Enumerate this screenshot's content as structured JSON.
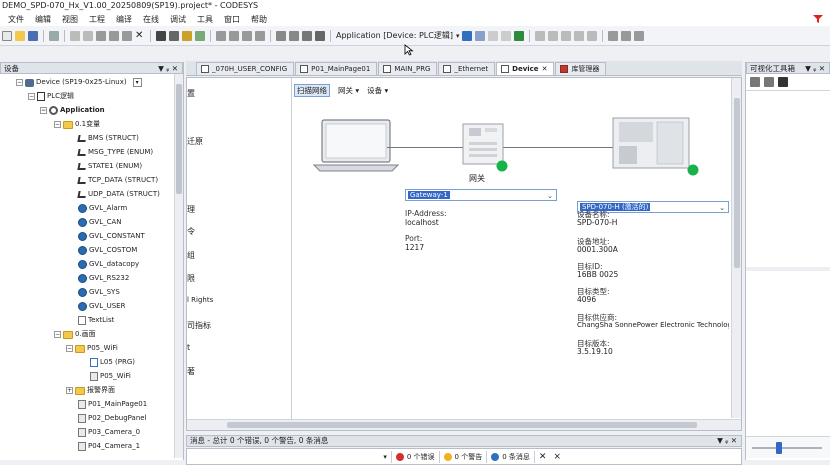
{
  "window": {
    "title": "DEMO_SPD-070_Hx_V1.00_20250809(SP19).project* - CODESYS"
  },
  "menu": [
    "文件",
    "编辑",
    "视图",
    "工程",
    "编译",
    "在线",
    "调试",
    "工具",
    "窗口",
    "帮助"
  ],
  "toolbar": {
    "application_label": "Application [Device: PLC逻辑]"
  },
  "devices_panel": {
    "title": "设备",
    "pin": "▼ ᵩ ✕",
    "tree": [
      {
        "label": "Device (SP19-0x25-Linux)",
        "icon": "device-icon",
        "level": 1,
        "toggle": "−"
      },
      {
        "label": "PLC逻辑",
        "icon": "plc-logic-icon",
        "level": 2,
        "toggle": "−"
      },
      {
        "label": "Application",
        "icon": "application-icon",
        "level": 3,
        "toggle": "−",
        "bold": true
      },
      {
        "label": "0.1变量",
        "icon": "folder-icon",
        "level": 4,
        "toggle": "−"
      },
      {
        "label": "BMS (STRUCT)",
        "icon": "struct-icon",
        "level": 5
      },
      {
        "label": "MSG_TYPE (ENUM)",
        "icon": "enum-icon",
        "level": 5
      },
      {
        "label": "STATE1 (ENUM)",
        "icon": "enum-icon",
        "level": 5
      },
      {
        "label": "TCP_DATA (STRUCT)",
        "icon": "struct-icon",
        "level": 5
      },
      {
        "label": "UDP_DATA (STRUCT)",
        "icon": "struct-icon",
        "level": 5
      },
      {
        "label": "GVL_Alarm",
        "icon": "gvl-icon",
        "level": 5
      },
      {
        "label": "GVL_CAN",
        "icon": "gvl-icon",
        "level": 5
      },
      {
        "label": "GVL_CONSTANT",
        "icon": "gvl-icon",
        "level": 5
      },
      {
        "label": "GVL_COSTOM",
        "icon": "gvl-icon",
        "level": 5
      },
      {
        "label": "GVL_datacopy",
        "icon": "gvl-icon",
        "level": 5
      },
      {
        "label": "GVL_RS232",
        "icon": "gvl-icon",
        "level": 5
      },
      {
        "label": "GVL_SYS",
        "icon": "gvl-icon",
        "level": 5
      },
      {
        "label": "GVL_USER",
        "icon": "gvl-icon",
        "level": 5
      },
      {
        "label": "TextList",
        "icon": "textlist-icon",
        "level": 5
      },
      {
        "label": "0.画面",
        "icon": "folder-icon",
        "level": 4,
        "toggle": "−"
      },
      {
        "label": "P05_WiFi",
        "icon": "folder-icon",
        "level": 5,
        "toggle": "−"
      },
      {
        "label": "L05 (PRG)",
        "icon": "program-icon",
        "level": 6
      },
      {
        "label": "P05_WiFi",
        "icon": "visu-icon",
        "level": 6
      },
      {
        "label": "报警界面",
        "icon": "folder-icon",
        "level": 5,
        "toggle": "+"
      },
      {
        "label": "P01_MainPage01",
        "icon": "visu-icon",
        "level": 5
      },
      {
        "label": "P02_DebugPanel",
        "icon": "visu-icon",
        "level": 5
      },
      {
        "label": "P03_Camera_0",
        "icon": "visu-icon",
        "level": 5
      },
      {
        "label": "P04_Camera_1",
        "icon": "visu-icon",
        "level": 5
      }
    ]
  },
  "editor_tabs": [
    {
      "label": "_070H_USER_CONFIG",
      "active": false
    },
    {
      "label": "P01_MainPage01",
      "active": false
    },
    {
      "label": "MAIN_PRG",
      "active": false
    },
    {
      "label": "_Ethernet",
      "active": false
    },
    {
      "label": "Device",
      "active": true,
      "close": "✕"
    },
    {
      "label": "库管理器",
      "active": false
    }
  ],
  "device_editor": {
    "sidebar": [
      "置",
      "迁原",
      "理",
      "令",
      "组",
      "限",
      "l Rights",
      "司指标",
      "t",
      "著"
    ],
    "toolbar": {
      "scan": "扫描网络",
      "gateway": "网关 ▾",
      "device": "设备 ▾"
    },
    "gateway_node": {
      "caption": "网关",
      "dropdown": "Gateway-1",
      "ip_label": "IP-Address:",
      "ip_value": "localhost",
      "port_label": "Port:",
      "port_value": "1217"
    },
    "device_node": {
      "dropdown": "SPD-070-H (激活的)",
      "name_label": "设备名称:",
      "name_value": "SPD-070-H",
      "address_label": "设备地址:",
      "address_value": "0001.300A",
      "target_id_label": "目标ID:",
      "target_id_value": "16BB 0025",
      "target_type_label": "目标类型:",
      "target_type_value": "4096",
      "vendor_label": "目标供应商:",
      "vendor_value": "ChangSha SonnePower Electronic Technology",
      "version_label": "目标版本:",
      "version_value": "3.5.19.10"
    }
  },
  "toolbox_panel": {
    "title": "可视化工具箱",
    "pin": "▼ ᵩ ✕"
  },
  "messages": {
    "title": "消息 - 总计 0 个错误, 0 个警告, 0 条消息",
    "pin": "▼ ᵩ ✕",
    "errors": "0 个错误",
    "warnings": "0 个警告",
    "messages": "0 条消息"
  },
  "colors": {
    "accent": "#3368c8",
    "status_green": "#17b34a"
  }
}
